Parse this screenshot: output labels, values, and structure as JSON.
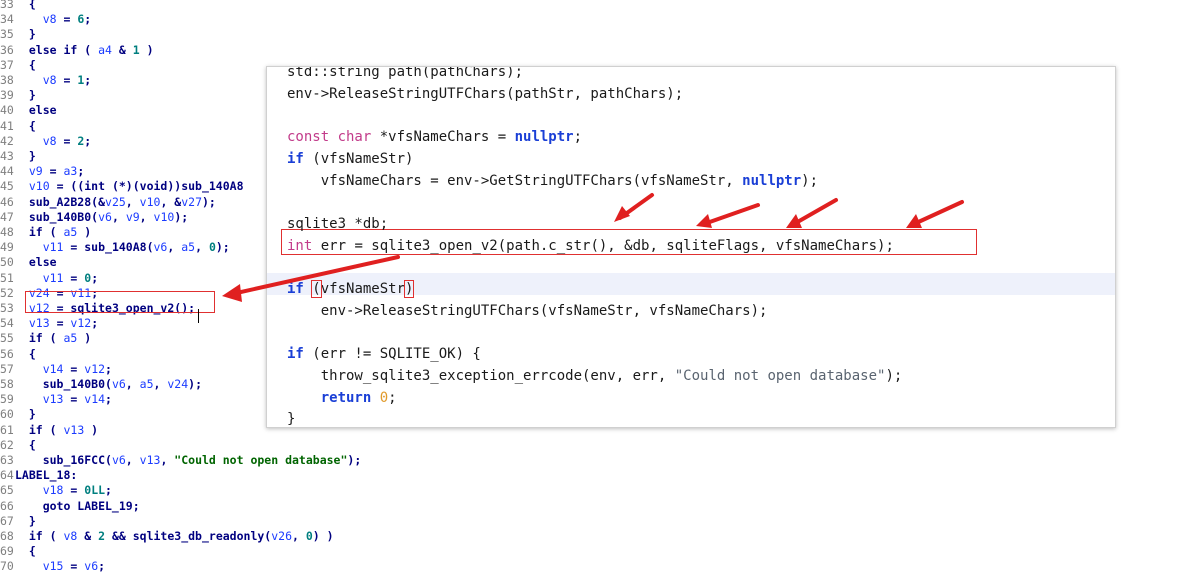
{
  "ida_pane": {
    "lines": [
      {
        "ln": "33",
        "html": "{"
      },
      {
        "ln": "34",
        "html": "  <span class=\"var\">v8</span> = <span class=\"num\">6</span>;"
      },
      {
        "ln": "35",
        "html": "}"
      },
      {
        "ln": "36",
        "html": "else if ( <span class=\"var\">a4</span> &amp; <span class=\"num\">1</span> )"
      },
      {
        "ln": "37",
        "html": "{"
      },
      {
        "ln": "38",
        "html": "  <span class=\"var\">v8</span> = <span class=\"num\">1</span>;"
      },
      {
        "ln": "39",
        "html": "}"
      },
      {
        "ln": "40",
        "html": "else"
      },
      {
        "ln": "41",
        "html": "{"
      },
      {
        "ln": "42",
        "html": "  <span class=\"var\">v8</span> = <span class=\"num\">2</span>;"
      },
      {
        "ln": "43",
        "html": "}"
      },
      {
        "ln": "44",
        "html": "<span class=\"var\">v9</span> = <span class=\"var\">a3</span>;"
      },
      {
        "ln": "45",
        "html": "<span class=\"var\">v10</span> = ((int (*)(void))sub_140A8"
      },
      {
        "ln": "46",
        "html": "sub_A2B28(&amp;<span class=\"var\">v25</span>, <span class=\"var\">v10</span>, &amp;<span class=\"var\">v27</span>);"
      },
      {
        "ln": "47",
        "html": "sub_140B0(<span class=\"var\">v6</span>, <span class=\"var\">v9</span>, <span class=\"var\">v10</span>);"
      },
      {
        "ln": "48",
        "html": "if ( <span class=\"var\">a5</span> )"
      },
      {
        "ln": "49",
        "html": "  <span class=\"var\">v11</span> = sub_140A8(<span class=\"var\">v6</span>, <span class=\"var\">a5</span>, <span class=\"num\">0</span>);"
      },
      {
        "ln": "50",
        "html": "else"
      },
      {
        "ln": "51",
        "html": "  <span class=\"var\">v11</span> = <span class=\"num\">0</span>;"
      },
      {
        "ln": "52",
        "html": "<span class=\"var\">v24</span> = <span class=\"var\">v11</span>;"
      },
      {
        "ln": "53",
        "html": "<span class=\"var\">v12</span> = sqlite3_open_v2();"
      },
      {
        "ln": "54",
        "html": "<span class=\"var\">v13</span> = <span class=\"var\">v12</span>;"
      },
      {
        "ln": "55",
        "html": "if ( <span class=\"var\">a5</span> )"
      },
      {
        "ln": "56",
        "html": "{"
      },
      {
        "ln": "57",
        "html": "  <span class=\"var\">v14</span> = <span class=\"var\">v12</span>;"
      },
      {
        "ln": "58",
        "html": "  sub_140B0(<span class=\"var\">v6</span>, <span class=\"var\">a5</span>, <span class=\"var\">v24</span>);"
      },
      {
        "ln": "59",
        "html": "  <span class=\"var\">v13</span> = <span class=\"var\">v14</span>;"
      },
      {
        "ln": "60",
        "html": "}"
      },
      {
        "ln": "61",
        "html": "if ( <span class=\"var\">v13</span> )"
      },
      {
        "ln": "62",
        "html": "{"
      },
      {
        "ln": "63",
        "html": "  sub_16FCC(<span class=\"var\">v6</span>, <span class=\"var\">v13</span>, <span class=\"str\">\"Could not open database\"</span>);"
      },
      {
        "ln": "64",
        "html": "LABEL_18:",
        "outdent": true
      },
      {
        "ln": "65",
        "html": "  <span class=\"var\">v18</span> = <span class=\"num\">0LL</span>;"
      },
      {
        "ln": "66",
        "html": "  goto LABEL_19;"
      },
      {
        "ln": "67",
        "html": "}"
      },
      {
        "ln": "68",
        "html": "if ( <span class=\"var\">v8</span> &amp; <span class=\"num\">2</span> &amp;&amp; sqlite3_db_readonly(<span class=\"var\">v26</span>, <span class=\"num\">0</span>) )"
      },
      {
        "ln": "69",
        "html": "{"
      },
      {
        "ln": "70",
        "html": "  <span class=\"var\">v15</span> = <span class=\"var\">v6</span>;"
      }
    ]
  },
  "source_panel": {
    "lines": [
      {
        "html": "std::string path(pathChars);"
      },
      {
        "html": "env-&gt;ReleaseStringUTFChars(pathStr, pathChars);"
      },
      {
        "html": ""
      },
      {
        "html": "<span class=\"kw\" style=\"font-weight:normal;color:#c23b8a\">const char</span> *vfsNameChars = <span class=\"kw\">nullptr</span>;"
      },
      {
        "html": "<span class=\"kw\">if</span> (vfsNameStr)"
      },
      {
        "html": "    vfsNameChars = env-&gt;GetStringUTFChars(vfsNameStr, <span class=\"kw\">nullptr</span>);"
      },
      {
        "html": ""
      },
      {
        "html": "sqlite3 *db;"
      },
      {
        "html": "<span class=\"kt\">int</span> err = sqlite3_open_v2(path.c_str(), &amp;db, sqliteFlags, vfsNameChars);"
      },
      {
        "html": ""
      },
      {
        "html": "<span class=\"kw\">if</span> <span class=\"paren-hl\">(</span>vfsNameStr<span class=\"paren-hl\">)</span>"
      },
      {
        "html": "    env-&gt;ReleaseStringUTFChars(vfsNameStr, vfsNameChars);"
      },
      {
        "html": ""
      },
      {
        "html": "<span class=\"kw\">if</span> (err != SQLITE_OK) {"
      },
      {
        "html": "    throw_sqlite3_exception_errcode(env, err, <span class=\"str\">\"Could not open database\"</span>);"
      },
      {
        "html": "    <span class=\"kw\">return</span> <span class=\"num\">0</span>;"
      },
      {
        "html": "}"
      }
    ]
  },
  "colors": {
    "highlight_box": "#e03030",
    "arrow": "#e02020",
    "keyword": "#1a3fd6",
    "ida_text": "#000080"
  }
}
